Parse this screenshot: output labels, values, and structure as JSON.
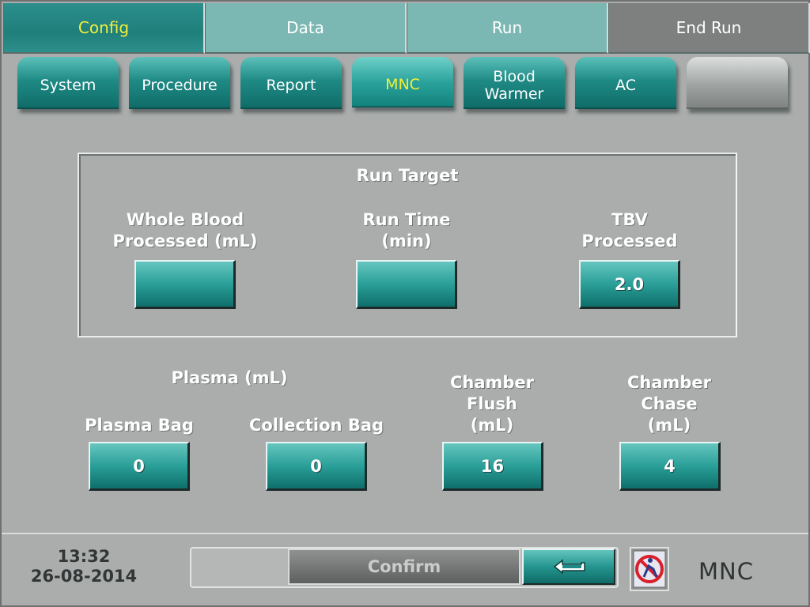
{
  "main_tabs": [
    {
      "label": "Config"
    },
    {
      "label": "Data"
    },
    {
      "label": "Run"
    },
    {
      "label": "End Run"
    }
  ],
  "sub_tabs": [
    {
      "label": "System"
    },
    {
      "label": "Procedure"
    },
    {
      "label": "Report"
    },
    {
      "label": "MNC"
    },
    {
      "label": "Blood Warmer"
    },
    {
      "label": "AC"
    },
    {
      "label": ""
    }
  ],
  "run_target": {
    "title": "Run Target",
    "whole_blood_label_1": "Whole Blood",
    "whole_blood_label_2": "Processed (mL)",
    "whole_blood_value": "",
    "run_time_label_1": "Run Time",
    "run_time_label_2": "(min)",
    "run_time_value": "",
    "tbv_label_1": "TBV",
    "tbv_label_2": "Processed",
    "tbv_value": "2.0"
  },
  "plasma": {
    "title": "Plasma (mL)",
    "plasma_bag_label": "Plasma Bag",
    "plasma_bag_value": "0",
    "collection_bag_label": "Collection Bag",
    "collection_bag_value": "0"
  },
  "chamber_flush": {
    "label_1": "Chamber",
    "label_2": "Flush",
    "label_3": "(mL)",
    "value": "16"
  },
  "chamber_chase": {
    "label_1": "Chamber",
    "label_2": "Chase",
    "label_3": "(mL)",
    "value": "4"
  },
  "bottom": {
    "time": "13:32",
    "date": "26-08-2014",
    "confirm_label": "Confirm",
    "back_icon": "return-arrow-icon",
    "status_icon": "no-patient-icon",
    "mode": "MNC"
  },
  "colors": {
    "accent_teal": "#1f8a85",
    "active_text": "#f3ef3a",
    "background": "#aaadac"
  }
}
